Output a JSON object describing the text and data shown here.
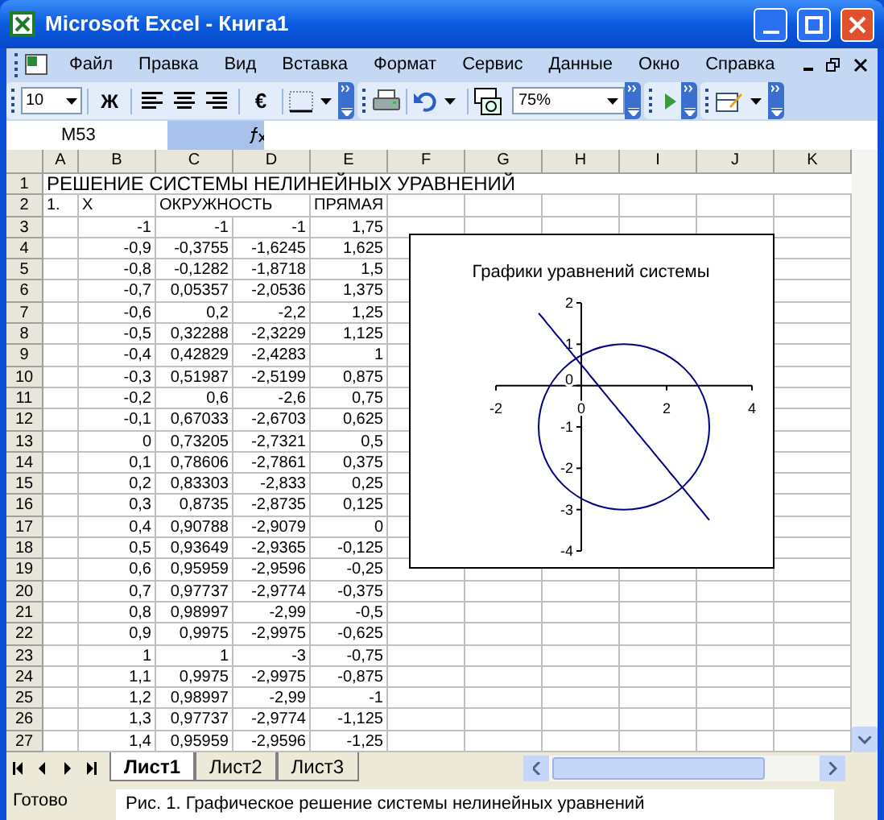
{
  "window": {
    "title": "Microsoft Excel - Книга1"
  },
  "menu": [
    "Файл",
    "Правка",
    "Вид",
    "Вставка",
    "Формат",
    "Сервис",
    "Данные",
    "Окно",
    "Справка"
  ],
  "toolbar": {
    "font_size": "10",
    "bold": "Ж",
    "currency": "€",
    "zoom": "75%"
  },
  "formula_bar": {
    "name_box": "M53"
  },
  "columns": [
    "A",
    "B",
    "C",
    "D",
    "E",
    "F",
    "G",
    "H",
    "I",
    "J",
    "K"
  ],
  "rows": [
    {
      "kind": "title",
      "number": "1",
      "a": "РЕШЕНИЕ СИСТЕМЫ НЕЛИНЕЙНЫХ УРАВНЕНИЙ"
    },
    {
      "kind": "header",
      "number": "2",
      "a": "1.",
      "b": "X",
      "c": "ОКРУЖНОСТЬ",
      "e": "ПРЯМАЯ"
    },
    {
      "kind": "data",
      "number": "3",
      "b": "-1",
      "c": "-1",
      "d": "-1",
      "e": "1,75"
    },
    {
      "kind": "data",
      "number": "4",
      "b": "-0,9",
      "c": "-0,3755",
      "d": "-1,6245",
      "e": "1,625"
    },
    {
      "kind": "data",
      "number": "5",
      "b": "-0,8",
      "c": "-0,1282",
      "d": "-1,8718",
      "e": "1,5"
    },
    {
      "kind": "data",
      "number": "6",
      "b": "-0,7",
      "c": "0,05357",
      "d": "-2,0536",
      "e": "1,375"
    },
    {
      "kind": "data",
      "number": "7",
      "b": "-0,6",
      "c": "0,2",
      "d": "-2,2",
      "e": "1,25"
    },
    {
      "kind": "data",
      "number": "8",
      "b": "-0,5",
      "c": "0,32288",
      "d": "-2,3229",
      "e": "1,125"
    },
    {
      "kind": "data",
      "number": "9",
      "b": "-0,4",
      "c": "0,42829",
      "d": "-2,4283",
      "e": "1"
    },
    {
      "kind": "data",
      "number": "10",
      "b": "-0,3",
      "c": "0,51987",
      "d": "-2,5199",
      "e": "0,875"
    },
    {
      "kind": "data",
      "number": "11",
      "b": "-0,2",
      "c": "0,6",
      "d": "-2,6",
      "e": "0,75"
    },
    {
      "kind": "data",
      "number": "12",
      "b": "-0,1",
      "c": "0,67033",
      "d": "-2,6703",
      "e": "0,625"
    },
    {
      "kind": "data",
      "number": "13",
      "b": "0",
      "c": "0,73205",
      "d": "-2,7321",
      "e": "0,5"
    },
    {
      "kind": "data",
      "number": "14",
      "b": "0,1",
      "c": "0,78606",
      "d": "-2,7861",
      "e": "0,375"
    },
    {
      "kind": "data",
      "number": "15",
      "b": "0,2",
      "c": "0,83303",
      "d": "-2,833",
      "e": "0,25"
    },
    {
      "kind": "data",
      "number": "16",
      "b": "0,3",
      "c": "0,8735",
      "d": "-2,8735",
      "e": "0,125"
    },
    {
      "kind": "data",
      "number": "17",
      "b": "0,4",
      "c": "0,90788",
      "d": "-2,9079",
      "e": "0"
    },
    {
      "kind": "data",
      "number": "18",
      "b": "0,5",
      "c": "0,93649",
      "d": "-2,9365",
      "e": "-0,125"
    },
    {
      "kind": "data",
      "number": "19",
      "b": "0,6",
      "c": "0,95959",
      "d": "-2,9596",
      "e": "-0,25"
    },
    {
      "kind": "data",
      "number": "20",
      "b": "0,7",
      "c": "0,97737",
      "d": "-2,9774",
      "e": "-0,375"
    },
    {
      "kind": "data",
      "number": "21",
      "b": "0,8",
      "c": "0,98997",
      "d": "-2,99",
      "e": "-0,5"
    },
    {
      "kind": "data",
      "number": "22",
      "b": "0,9",
      "c": "0,9975",
      "d": "-2,9975",
      "e": "-0,625"
    },
    {
      "kind": "data",
      "number": "23",
      "b": "1",
      "c": "1",
      "d": "-3",
      "e": "-0,75"
    },
    {
      "kind": "data",
      "number": "24",
      "b": "1,1",
      "c": "0,9975",
      "d": "-2,9975",
      "e": "-0,875"
    },
    {
      "kind": "data",
      "number": "25",
      "b": "1,2",
      "c": "0,98997",
      "d": "-2,99",
      "e": "-1"
    },
    {
      "kind": "data",
      "number": "26",
      "b": "1,3",
      "c": "0,97737",
      "d": "-2,9774",
      "e": "-1,125"
    },
    {
      "kind": "data",
      "number": "27",
      "b": "1,4",
      "c": "0,95959",
      "d": "-2,9596",
      "e": "-1,25"
    }
  ],
  "chart": {
    "chart_data": {
      "type": "line",
      "title": "Графики уравнений системы",
      "xlim": [
        -2,
        4
      ],
      "ylim": [
        -4,
        2
      ],
      "xticks": [
        -2,
        0,
        2,
        4
      ],
      "yticks": [
        -4,
        -3,
        -2,
        -1,
        0,
        1,
        2
      ],
      "x": [
        -1,
        -0.9,
        -0.8,
        -0.7,
        -0.6,
        -0.5,
        -0.4,
        -0.3,
        -0.2,
        -0.1,
        0,
        0.1,
        0.2,
        0.3,
        0.4,
        0.5,
        0.6,
        0.7,
        0.8,
        0.9,
        1,
        1.1,
        1.2,
        1.3,
        1.4,
        1.5,
        1.6,
        1.7,
        1.8,
        1.9,
        2,
        2.1,
        2.2,
        2.3,
        2.4,
        2.5,
        2.6,
        2.7,
        2.8,
        2.9,
        3
      ],
      "series": [
        {
          "color": "#000080",
          "values": [
            1.75,
            1.63,
            1.5,
            1.38,
            1.25,
            1.13,
            1,
            0.88,
            0.75,
            0.63,
            0.5,
            0.38,
            0.25,
            0.13,
            0,
            -0.13,
            -0.25,
            -0.38,
            -0.5,
            -0.63,
            -0.75,
            -0.88,
            -1,
            -1.13,
            -1.25,
            -1.38,
            -1.5,
            -1.63,
            -1.75,
            -1.88,
            -2,
            -2.13,
            -2.25,
            -2.38,
            -2.5,
            -2.63,
            -2.75,
            -2.88,
            -3,
            -3.13,
            -3.25
          ]
        }
      ]
    }
  },
  "sheet_tabs": [
    {
      "label": "Лист1",
      "selected": true
    },
    {
      "label": "Лист2",
      "selected": false
    },
    {
      "label": "Лист3",
      "selected": false
    }
  ],
  "status_bar": {
    "text": "Готово"
  },
  "caption": "Рис. 1. Графическое решение системы нелинейных уравнений"
}
